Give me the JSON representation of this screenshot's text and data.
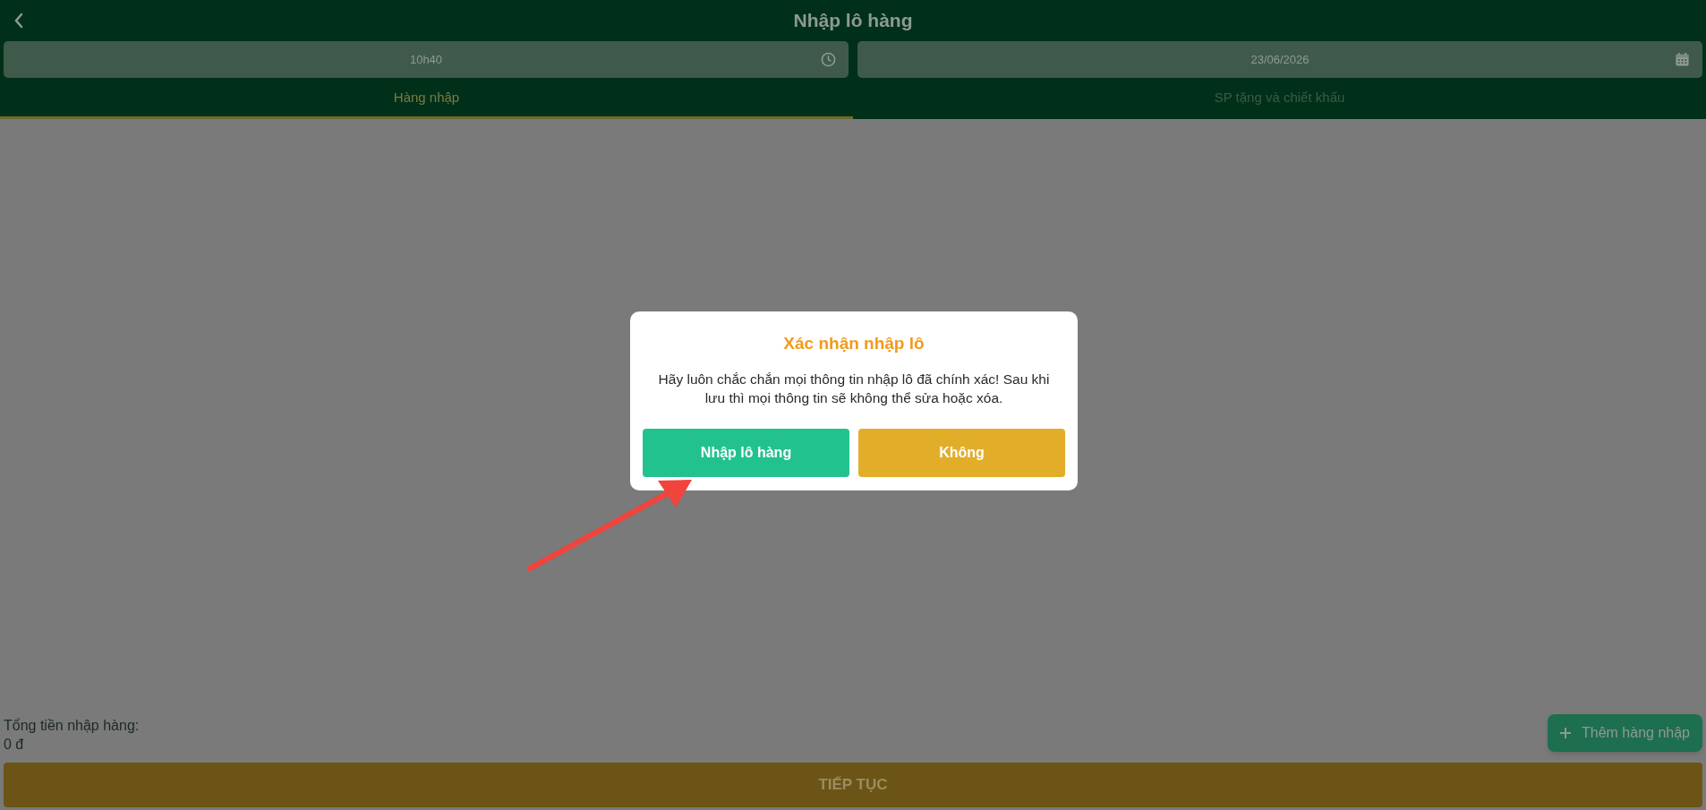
{
  "header": {
    "title": "Nhập lô hàng"
  },
  "fields": [
    {
      "kind": "time",
      "value": "10h40"
    },
    {
      "kind": "date",
      "value": "23/06/2026"
    }
  ],
  "tabs": [
    {
      "label": "Hàng nhập",
      "selected": true
    },
    {
      "label": "SP tặng và chiết khấu",
      "selected": false
    }
  ],
  "footer": {
    "total_label": "Tổng tiền nhập hàng:",
    "total_value": "0 đ",
    "add_button": "Thêm hàng nhập",
    "continue_button": "TIẾP TỤC"
  },
  "dialog": {
    "title": "Xác nhận nhập lô",
    "message": "Hãy luôn chắc chắn mọi thông tin nhập lô đã chính xác! Sau khi lưu thì mọi thông tin sẽ không thể sửa hoặc xóa.",
    "buttons": [
      {
        "kind": "confirm",
        "label": "Nhập lô hàng"
      },
      {
        "kind": "cancel",
        "label": "Không"
      }
    ]
  }
}
